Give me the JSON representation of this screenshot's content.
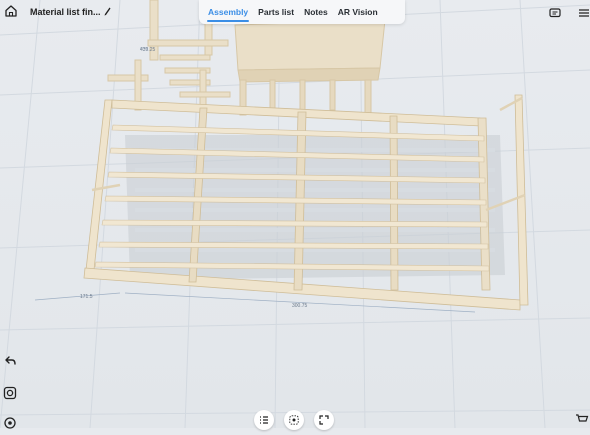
{
  "header": {
    "title": "Material list fin...",
    "tabs": [
      {
        "label": "Assembly",
        "active": true
      },
      {
        "label": "Parts list",
        "active": false
      },
      {
        "label": "Notes",
        "active": false
      },
      {
        "label": "AR Vision",
        "active": false
      }
    ]
  },
  "dimensions": {
    "left": "171.5",
    "bottom": "300.75",
    "top": "439.25"
  },
  "colors": {
    "accent": "#3b8ee6",
    "lumber": "#e9dcc2",
    "grid": "#d5dbe2"
  },
  "icons": [
    "home-icon",
    "edit-icon",
    "chat-icon",
    "menu-icon",
    "undo-icon",
    "camera-icon",
    "settings-icon",
    "list-icon",
    "focus-icon",
    "expand-icon",
    "cart-icon"
  ]
}
